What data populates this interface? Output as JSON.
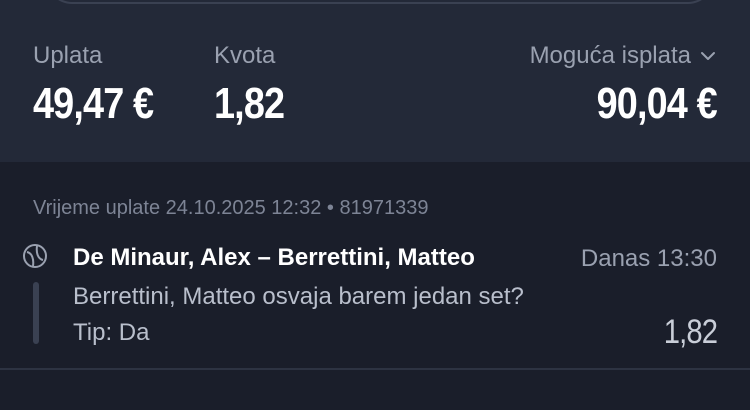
{
  "summary": {
    "stake_label": "Uplata",
    "stake_value": "49,47 €",
    "odds_label": "Kvota",
    "odds_value": "1,82",
    "payout_label": "Moguća isplata",
    "payout_value": "90,04 €",
    "payout_icon": "chevron-down-icon"
  },
  "ticket": {
    "meta": "Vrijeme uplate 24.10.2025 12:32 • 81971339",
    "status_icon": "sport-tennis-icon",
    "event_name": "De Minaur, Alex – Berrettini, Matteo",
    "event_time": "Danas 13:30",
    "market": "Berrettini, Matteo osvaja barem jedan set?",
    "tip": "Tip: Da",
    "odd": "1,82"
  },
  "colors": {
    "background": "#1a1e2a",
    "panel": "#232938",
    "text_primary": "#ffffff",
    "text_secondary": "#9aa1b0"
  }
}
